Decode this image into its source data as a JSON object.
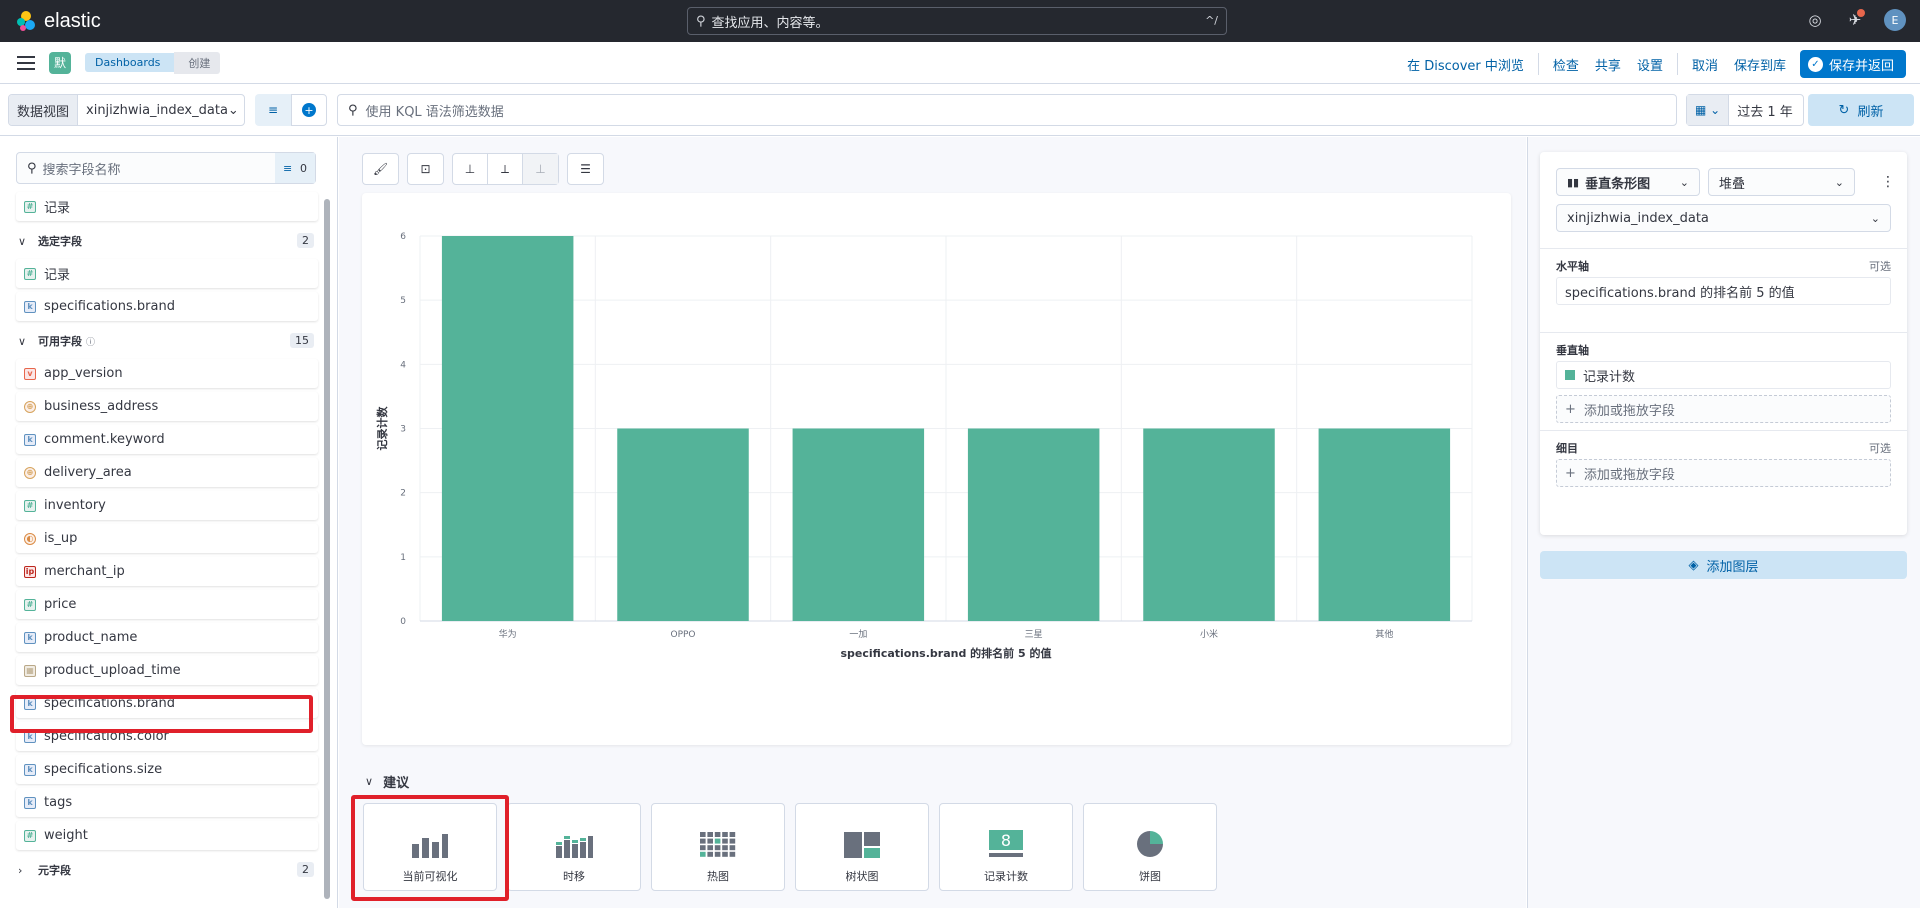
{
  "header": {
    "app_name": "elastic",
    "search_placeholder": "查找应用、内容等。",
    "search_shortcut": "^/",
    "avatar_letter": "E"
  },
  "subheader": {
    "space_initial": "默",
    "breadcrumbs": [
      "Dashboards",
      "创建"
    ],
    "links": [
      "在 Discover 中浏览",
      "检查",
      "共享",
      "设置",
      "取消",
      "保存到库"
    ],
    "primary_button": "保存并返回"
  },
  "query": {
    "data_view_label": "数据视图",
    "data_view_value": "xinjizhwia_index_data",
    "kql_placeholder": "使用 KQL 语法筛选数据",
    "date_range": "过去 1 年",
    "refresh_label": "刷新"
  },
  "sidebar": {
    "search_placeholder": "搜索字段名称",
    "filter_count": "0",
    "top_field": {
      "type": "num",
      "name": "记录"
    },
    "selected_group": {
      "label": "选定字段",
      "count": "2"
    },
    "selected_fields": [
      {
        "type": "num",
        "name": "记录"
      },
      {
        "type": "kw",
        "name": "specifications.brand"
      }
    ],
    "available_group": {
      "label": "可用字段",
      "count": "15"
    },
    "available_fields": [
      {
        "type": "ver",
        "name": "app_version"
      },
      {
        "type": "geo",
        "name": "business_address"
      },
      {
        "type": "kw",
        "name": "comment.keyword"
      },
      {
        "type": "geo",
        "name": "delivery_area"
      },
      {
        "type": "num",
        "name": "inventory"
      },
      {
        "type": "bool",
        "name": "is_up"
      },
      {
        "type": "ip",
        "name": "merchant_ip"
      },
      {
        "type": "num",
        "name": "price"
      },
      {
        "type": "kw",
        "name": "product_name"
      },
      {
        "type": "date",
        "name": "product_upload_time"
      },
      {
        "type": "kw",
        "name": "specifications.brand"
      },
      {
        "type": "kw",
        "name": "specifications.color"
      },
      {
        "type": "kw",
        "name": "specifications.size"
      },
      {
        "type": "kw",
        "name": "tags"
      },
      {
        "type": "num",
        "name": "weight"
      }
    ],
    "meta_group": {
      "label": "元字段",
      "count": "2"
    }
  },
  "chart_data": {
    "type": "bar",
    "categories": [
      "华为",
      "OPPO",
      "一加",
      "三星",
      "小米",
      "其他"
    ],
    "values": [
      6,
      3,
      3,
      3,
      3,
      3
    ],
    "xlabel": "specifications.brand 的排名前 5 的值",
    "ylabel": "记录计数",
    "ylim": [
      0,
      6
    ],
    "yticks": [
      0,
      1,
      2,
      3,
      4,
      5,
      6
    ],
    "color": "#54b399",
    "grid": true
  },
  "suggestions": {
    "title": "建议",
    "items": [
      "当前可视化",
      "时移",
      "热图",
      "树状图",
      "记录计数",
      "饼图"
    ],
    "metric_value": "8"
  },
  "config": {
    "chart_type": "垂直条形图",
    "mode": "堆叠",
    "data_view": "xinjizhwia_index_data",
    "x_axis": {
      "title": "水平轴",
      "optional": "可选",
      "value": "specifications.brand 的排名前 5 的值"
    },
    "y_axis": {
      "title": "垂直轴",
      "value": "记录计数",
      "add": "添加或拖放字段"
    },
    "breakdown": {
      "title": "细目",
      "optional": "可选",
      "add": "添加或拖放字段"
    },
    "add_layer": "添加图层"
  }
}
